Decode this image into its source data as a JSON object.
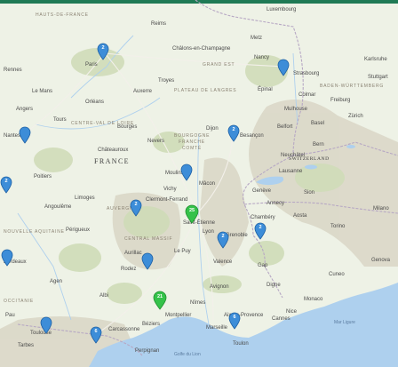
{
  "map": {
    "colors": {
      "land": "#eef2e6",
      "water": "#aed0ee",
      "forest": "#cfdcb8",
      "terrain": "#d9d6c6",
      "border": "#b7a8c4",
      "road": "#f3f0ea",
      "marker_blue": "#3d8dd8",
      "marker_green": "#35c24a",
      "topbar": "#1f7a55"
    },
    "countries": [
      {
        "id": "country-france",
        "label": "FRANCE"
      },
      {
        "id": "country-switzerland",
        "label": "SWITZERLAND"
      }
    ],
    "regions": [
      {
        "id": "region-grand-est",
        "label": "GRAND EST"
      },
      {
        "id": "region-plateau-de-langres",
        "label": "PLATEAU DE LANGRES"
      },
      {
        "id": "region-bourgogne",
        "label": "BOURGOGNE FRANCHE COMTÉ"
      },
      {
        "id": "region-central-massif",
        "label": "CENTRAL MASSIF"
      },
      {
        "id": "region-aquitaine",
        "label": "NOUVELLE AQUITAINE"
      },
      {
        "id": "region-auvergne",
        "label": "AUVERGNE"
      },
      {
        "id": "region-occitanie",
        "label": "OCCITANIE"
      },
      {
        "id": "region-hauts-de-france",
        "label": "HAUTS-DE-FRANCE"
      },
      {
        "id": "region-centre",
        "label": "CENTRE-VAL DE LOIRE"
      },
      {
        "id": "region-baden",
        "label": "BADEN-WÜRTTEMBERG"
      }
    ],
    "cities": [
      {
        "id": "paris",
        "label": "Paris"
      },
      {
        "id": "lyon",
        "label": "Lyon"
      },
      {
        "id": "dijon",
        "label": "Dijon"
      },
      {
        "id": "besancon",
        "label": "Besançon"
      },
      {
        "id": "strasbourg",
        "label": "Strasbourg"
      },
      {
        "id": "nancy",
        "label": "Nancy"
      },
      {
        "id": "metz",
        "label": "Metz"
      },
      {
        "id": "reims",
        "label": "Reims"
      },
      {
        "id": "chalons",
        "label": "Châlons-en-Champagne"
      },
      {
        "id": "troyes",
        "label": "Troyes"
      },
      {
        "id": "orleans",
        "label": "Orléans"
      },
      {
        "id": "tours",
        "label": "Tours"
      },
      {
        "id": "le-mans",
        "label": "Le Mans"
      },
      {
        "id": "poitiers",
        "label": "Poitiers"
      },
      {
        "id": "limoges",
        "label": "Limoges"
      },
      {
        "id": "clermont",
        "label": "Clermont-Ferrand"
      },
      {
        "id": "saint-etienne",
        "label": "Saint-Étienne"
      },
      {
        "id": "grenoble",
        "label": "Grenoble"
      },
      {
        "id": "geneva",
        "label": "Genève"
      },
      {
        "id": "lausanne",
        "label": "Lausanne"
      },
      {
        "id": "bern",
        "label": "Bern"
      },
      {
        "id": "zurich",
        "label": "Zürich"
      },
      {
        "id": "basel",
        "label": "Basel"
      },
      {
        "id": "freiburg",
        "label": "Freiburg"
      },
      {
        "id": "mulhouse",
        "label": "Mulhouse"
      },
      {
        "id": "bordeaux",
        "label": "Bordeaux"
      },
      {
        "id": "toulouse",
        "label": "Toulouse"
      },
      {
        "id": "montpellier",
        "label": "Montpellier"
      },
      {
        "id": "nimes",
        "label": "Nîmes"
      },
      {
        "id": "avignon",
        "label": "Avignon"
      },
      {
        "id": "marseille",
        "label": "Marseille"
      },
      {
        "id": "toulon",
        "label": "Toulon"
      },
      {
        "id": "nice",
        "label": "Nice"
      },
      {
        "id": "turin",
        "label": "Torino"
      },
      {
        "id": "milan",
        "label": "Milano"
      },
      {
        "id": "perpignan",
        "label": "Perpignan"
      },
      {
        "id": "carcassonne",
        "label": "Carcassonne"
      },
      {
        "id": "luxembourg",
        "label": "Luxembourg"
      },
      {
        "id": "karlsruhe",
        "label": "Karlsruhe"
      },
      {
        "id": "stuttgart",
        "label": "Stuttgart"
      },
      {
        "id": "angers",
        "label": "Angers"
      },
      {
        "id": "nantes",
        "label": "Nantes"
      },
      {
        "id": "rennes",
        "label": "Rennes"
      },
      {
        "id": "bourges",
        "label": "Bourges"
      },
      {
        "id": "nevers",
        "label": "Nevers"
      },
      {
        "id": "chateauroux",
        "label": "Châteauroux"
      },
      {
        "id": "angouleme",
        "label": "Angoulême"
      },
      {
        "id": "perigueux",
        "label": "Périgueux"
      },
      {
        "id": "agen",
        "label": "Agen"
      },
      {
        "id": "rodez",
        "label": "Rodez"
      },
      {
        "id": "albi",
        "label": "Albi"
      },
      {
        "id": "valence",
        "label": "Valence"
      },
      {
        "id": "annecy",
        "label": "Annecy"
      },
      {
        "id": "chambery",
        "label": "Chambéry"
      },
      {
        "id": "gap",
        "label": "Gap"
      },
      {
        "id": "digne",
        "label": "Digne"
      },
      {
        "id": "aix",
        "label": "Aix-en-Provence"
      },
      {
        "id": "beziers",
        "label": "Béziers"
      },
      {
        "id": "pau",
        "label": "Pau"
      },
      {
        "id": "tarbes",
        "label": "Tarbes"
      },
      {
        "id": "auxerre",
        "label": "Auxerre"
      },
      {
        "id": "macon",
        "label": "Mâcon"
      },
      {
        "id": "moulins",
        "label": "Moulins"
      },
      {
        "id": "vichy",
        "label": "Vichy"
      },
      {
        "id": "le-puy",
        "label": "Le Puy"
      },
      {
        "id": "aurillac",
        "label": "Aurillac"
      },
      {
        "id": "epinal",
        "label": "Épinal"
      },
      {
        "id": "colmar",
        "label": "Colmar"
      },
      {
        "id": "belfort",
        "label": "Belfort"
      },
      {
        "id": "neuchatel",
        "label": "Neuchâtel"
      },
      {
        "id": "sion",
        "label": "Sion"
      },
      {
        "id": "aosta",
        "label": "Aosta"
      },
      {
        "id": "cuneo",
        "label": "Cuneo"
      },
      {
        "id": "genova",
        "label": "Genova"
      },
      {
        "id": "monaco",
        "label": "Monaco"
      },
      {
        "id": "cannes",
        "label": "Cannes"
      }
    ],
    "sea": [
      {
        "id": "gulf-lion",
        "label": "Golfe du Lion"
      },
      {
        "id": "ligurian",
        "label": "Mar Ligure"
      }
    ],
    "markers": [
      {
        "id": "m1",
        "color": "blue",
        "count": "2"
      },
      {
        "id": "m2",
        "color": "blue",
        "count": ""
      },
      {
        "id": "m3",
        "color": "blue",
        "count": ""
      },
      {
        "id": "m4",
        "color": "blue",
        "count": "2"
      },
      {
        "id": "m5",
        "color": "blue",
        "count": ""
      },
      {
        "id": "m6",
        "color": "blue",
        "count": "2"
      },
      {
        "id": "m7",
        "color": "blue",
        "count": "2"
      },
      {
        "id": "m8",
        "color": "green",
        "count": "25"
      },
      {
        "id": "m9",
        "color": "blue",
        "count": "2"
      },
      {
        "id": "m10",
        "color": "blue",
        "count": "2"
      },
      {
        "id": "m11",
        "color": "blue",
        "count": ""
      },
      {
        "id": "m12",
        "color": "blue",
        "count": ""
      },
      {
        "id": "m13",
        "color": "green",
        "count": "21"
      },
      {
        "id": "m14",
        "color": "blue",
        "count": ""
      },
      {
        "id": "m15",
        "color": "blue",
        "count": "6"
      },
      {
        "id": "m16",
        "color": "blue",
        "count": "6"
      },
      {
        "id": "m17",
        "color": "blue",
        "count": "8"
      }
    ]
  }
}
